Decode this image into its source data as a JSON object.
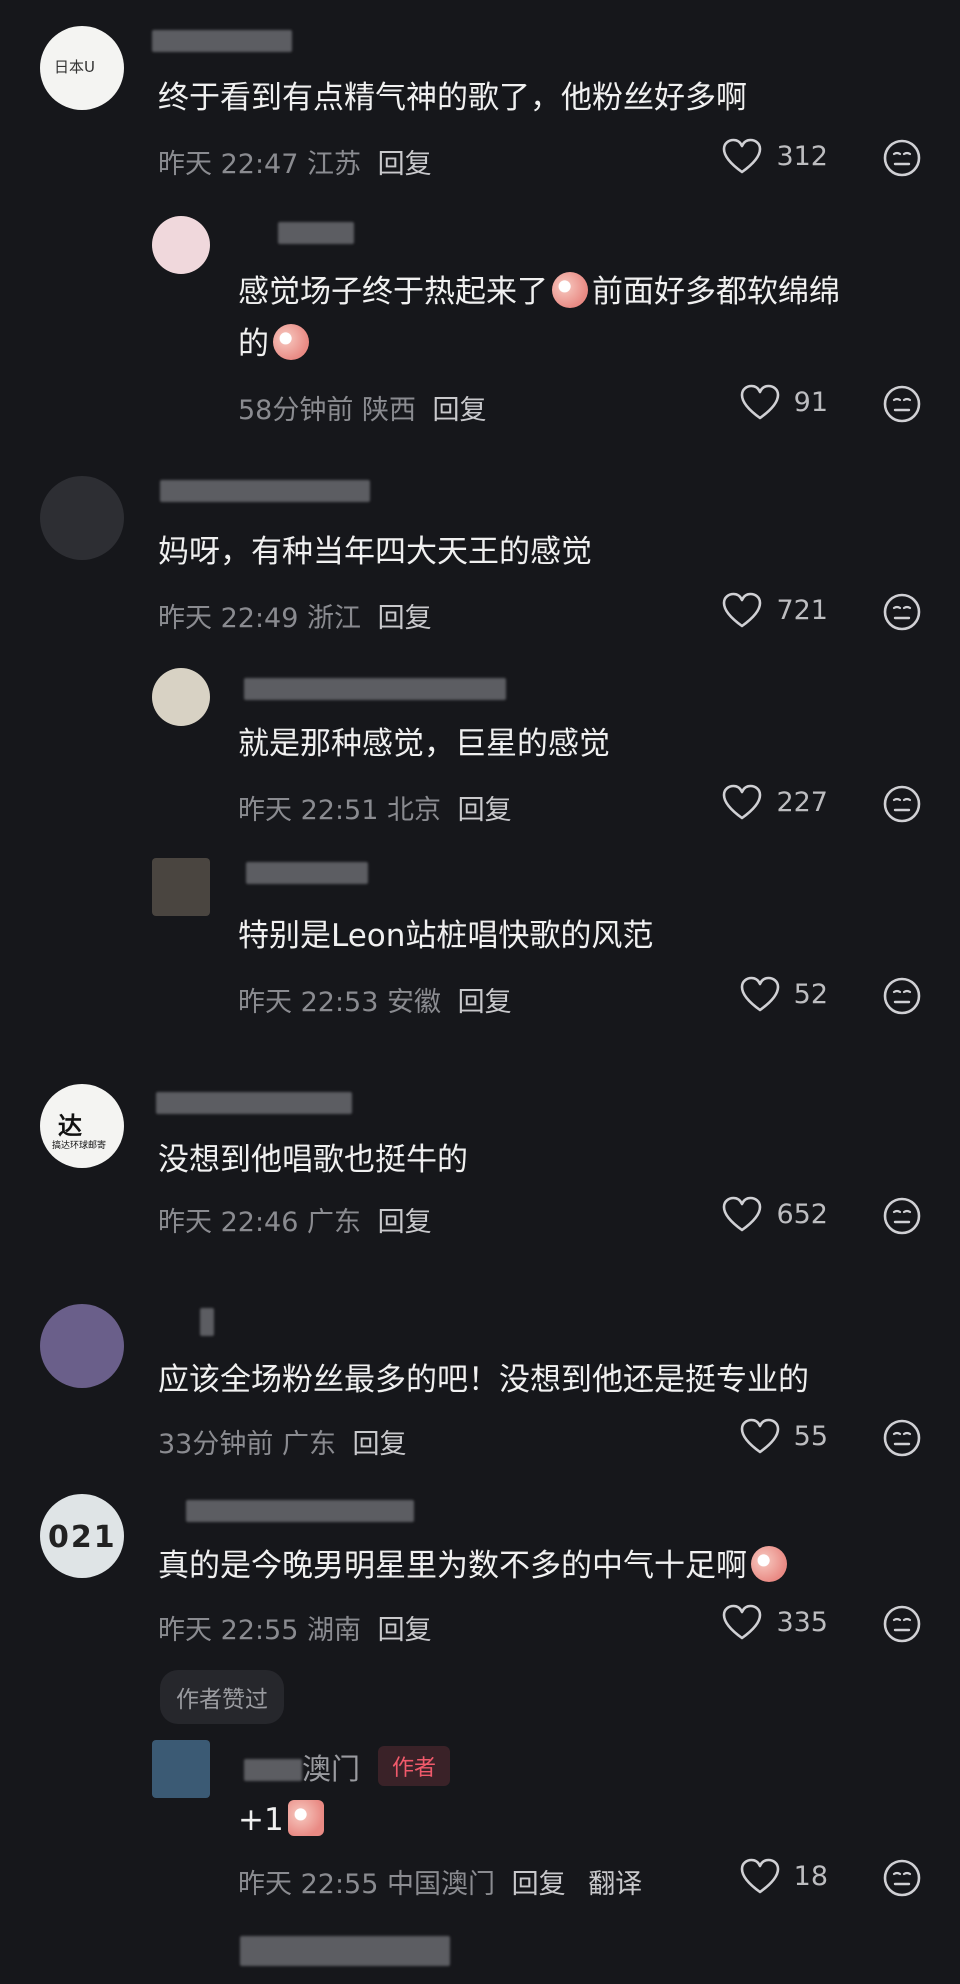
{
  "comments": [
    {
      "text": "终于看到有点精气神的歌了，他粉丝好多啊",
      "time": "昨天 22:47",
      "region": "江苏",
      "reply": "回复",
      "likes": "312"
    },
    {
      "text_a": "感觉场子终于热起来了",
      "text_b": "前面好多都软绵绵",
      "text_c": "的",
      "time": "58分钟前",
      "region": "陕西",
      "reply": "回复",
      "likes": "91"
    },
    {
      "text": "妈呀，有种当年四大天王的感觉",
      "time": "昨天 22:49",
      "region": "浙江",
      "reply": "回复",
      "likes": "721"
    },
    {
      "text": "就是那种感觉，巨星的感觉",
      "time": "昨天 22:51",
      "region": "北京",
      "reply": "回复",
      "likes": "227"
    },
    {
      "text": "特别是Leon站桩唱快歌的风范",
      "time": "昨天 22:53",
      "region": "安徽",
      "reply": "回复",
      "likes": "52"
    },
    {
      "text": "没想到他唱歌也挺牛的",
      "time": "昨天 22:46",
      "region": "广东",
      "reply": "回复",
      "likes": "652"
    },
    {
      "text": "应该全场粉丝最多的吧！没想到他还是挺专业的",
      "time": "33分钟前",
      "region": "广东",
      "reply": "回复",
      "likes": "55"
    },
    {
      "text": "真的是今晚男明星里为数不多的中气十足啊",
      "time": "昨天 22:55",
      "region": "湖南",
      "reply": "回复",
      "likes": "335"
    },
    {
      "name_visible": "澳门",
      "author_badge": "作者",
      "text": "+1",
      "time": "昨天 22:55",
      "region": "中国澳门",
      "reply": "回复",
      "translate": "翻译",
      "likes": "18"
    }
  ],
  "author_liked_tag": "作者赞过",
  "avatar_logos": {
    "first": "日本U",
    "dada": "达",
    "dada_sub": "搞达环球邮寄",
    "ticket": "021"
  },
  "colors": {
    "background": "#16171b",
    "text": "#f0f0f0",
    "meta": "#8a8b90",
    "author_badge": "#f05a6b"
  }
}
